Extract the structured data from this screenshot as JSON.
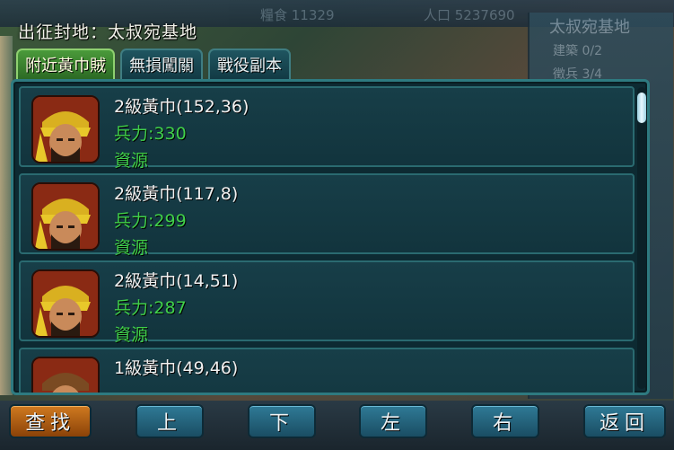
{
  "dialog": {
    "title": "出征封地：太叔宛基地",
    "tabs": [
      {
        "label": "附近黃巾賊",
        "active": true
      },
      {
        "label": "無損闖關",
        "active": false
      },
      {
        "label": "戰役副本",
        "active": false
      }
    ],
    "rows": [
      {
        "name": "2級黃巾(152,36)",
        "troops": "兵力:330",
        "resource": "資源"
      },
      {
        "name": "2級黃巾(117,8)",
        "troops": "兵力:299",
        "resource": "資源"
      },
      {
        "name": "2級黃巾(14,51)",
        "troops": "兵力:287",
        "resource": "資源"
      },
      {
        "name": "1級黃巾(49,46)",
        "troops": "",
        "resource": ""
      }
    ]
  },
  "background": {
    "top_bar": [
      "糧食 11329",
      "人口 5237690"
    ],
    "right_panel_title": "太叔宛基地",
    "right_panel_rows": [
      "建築 0/2",
      "徵兵 3/4"
    ]
  },
  "buttons": {
    "search": "查找",
    "up": "上",
    "down": "下",
    "left": "左",
    "right": "右",
    "back": "返回"
  },
  "colors": {
    "troops_text": "#40d04a",
    "active_tab": "#4a9a3a",
    "panel_bg": "#0d2a32"
  }
}
